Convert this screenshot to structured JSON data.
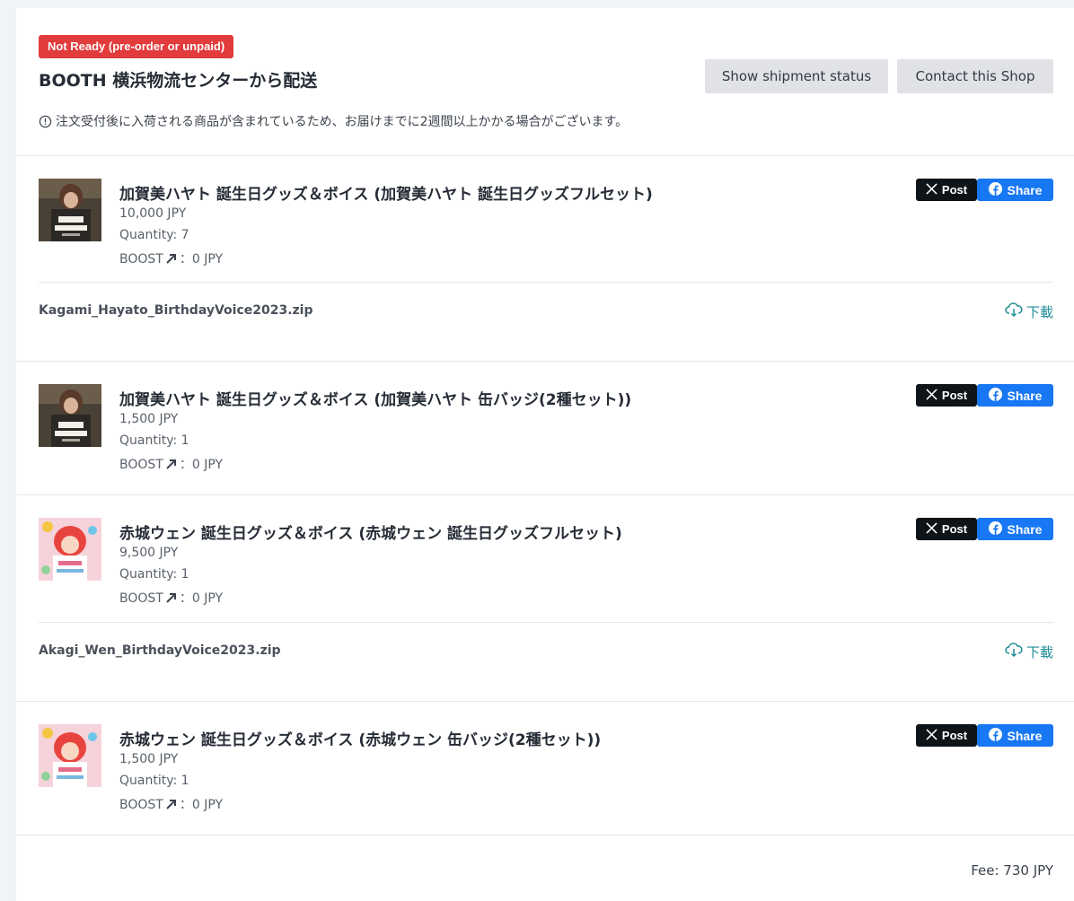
{
  "shipment": {
    "status_badge": "Not Ready (pre-order or unpaid)",
    "title": "BOOTH 横浜物流センターから配送",
    "show_status_label": "Show shipment status",
    "contact_label": "Contact this Shop",
    "notice": "注文受付後に入荷される商品が含まれているため、お届けまでに2週間以上かかる場合がございます。"
  },
  "share": {
    "x_label": "Post",
    "fb_label": "Share"
  },
  "items": [
    {
      "title": "加賀美ハヤト 誕生日グッズ＆ボイス (加賀美ハヤト 誕生日グッズフルセット)",
      "price": "10,000 JPY",
      "quantity": "Quantity: 7",
      "boost_prefix": "BOOST",
      "boost_value": "：0 JPY",
      "download_file": "Kagami_Hayato_BirthdayVoice2023.zip",
      "download_label": "下載"
    },
    {
      "title": "加賀美ハヤト 誕生日グッズ＆ボイス (加賀美ハヤト 缶バッジ(2種セット))",
      "price": "1,500 JPY",
      "quantity": "Quantity: 1",
      "boost_prefix": "BOOST",
      "boost_value": "：0 JPY"
    },
    {
      "title": "赤城ウェン 誕生日グッズ＆ボイス (赤城ウェン 誕生日グッズフルセット)",
      "price": "9,500 JPY",
      "quantity": "Quantity: 1",
      "boost_prefix": "BOOST",
      "boost_value": "：0 JPY",
      "download_file": "Akagi_Wen_BirthdayVoice2023.zip",
      "download_label": "下載"
    },
    {
      "title": "赤城ウェン 誕生日グッズ＆ボイス (赤城ウェン 缶バッジ(2種セット))",
      "price": "1,500 JPY",
      "quantity": "Quantity: 1",
      "boost_prefix": "BOOST",
      "boost_value": "：0 JPY"
    }
  ],
  "fee": "Fee: 730 JPY",
  "colors": {
    "badge": "#e23b3b",
    "x_button": "#0f1419",
    "fb_button": "#1877f2",
    "download_link": "#1f8e97"
  }
}
